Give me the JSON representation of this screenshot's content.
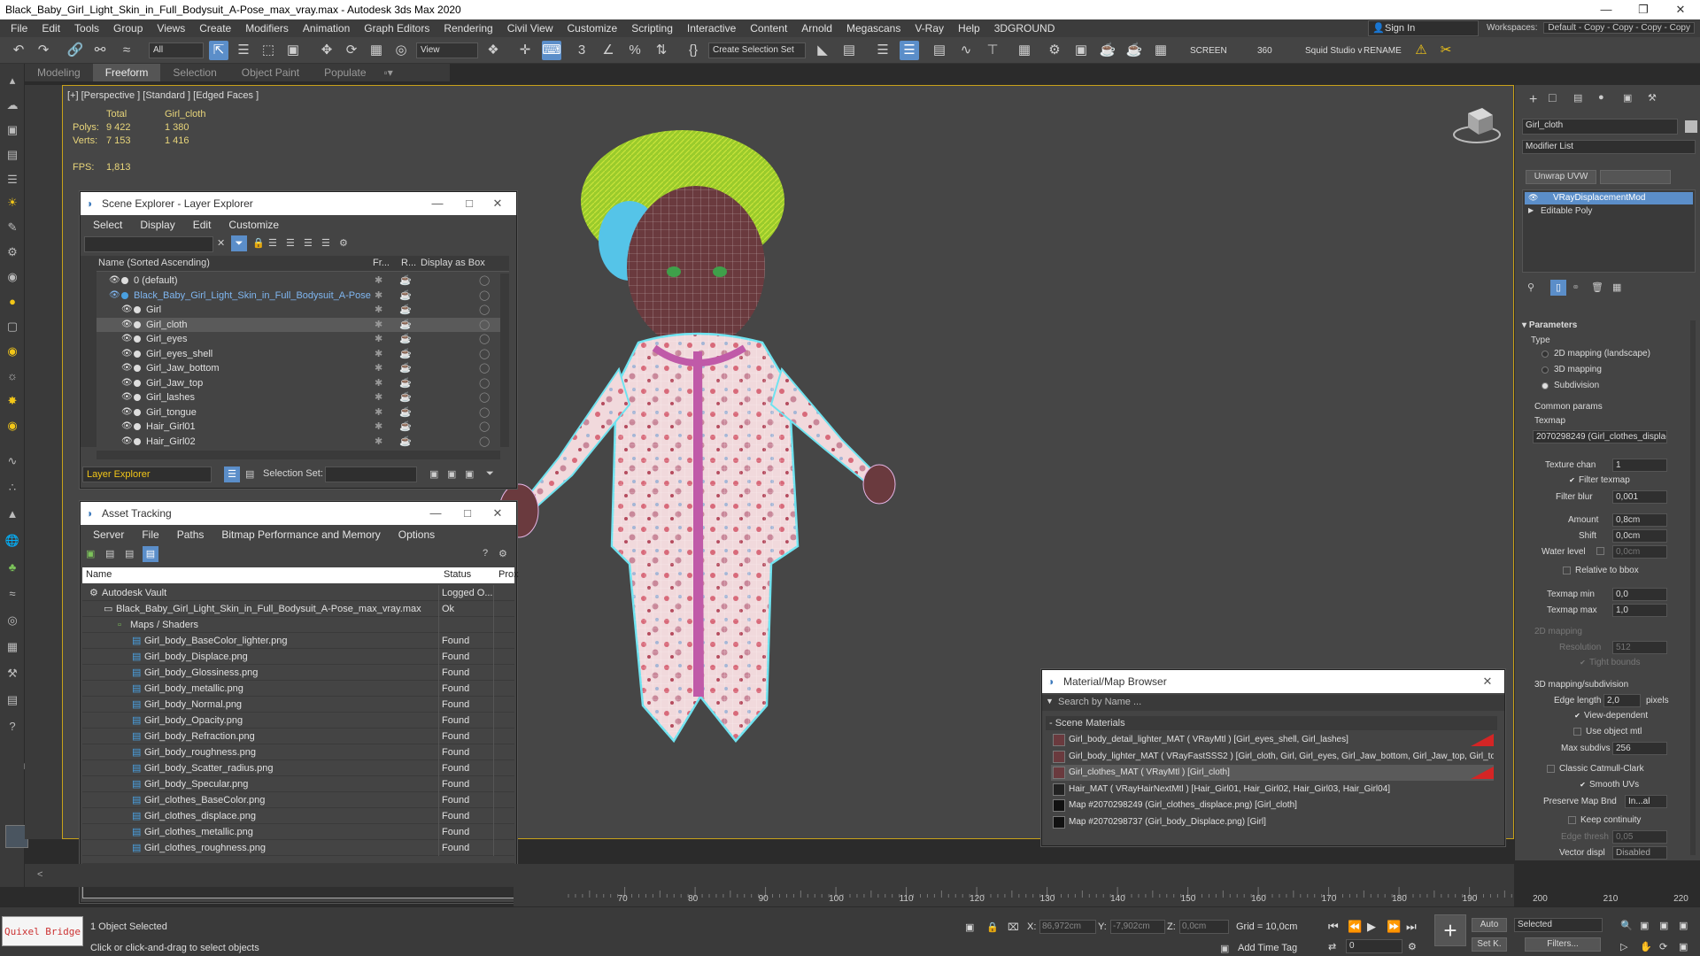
{
  "window": {
    "title": "Black_Baby_Girl_Light_Skin_in_Full_Bodysuit_A-Pose_max_vray.max - Autodesk 3ds Max 2020"
  },
  "menu": [
    "File",
    "Edit",
    "Tools",
    "Group",
    "Views",
    "Create",
    "Modifiers",
    "Animation",
    "Graph Editors",
    "Rendering",
    "Civil View",
    "Customize",
    "Scripting",
    "Interactive",
    "Content",
    "Arnold",
    "Megascans",
    "V-Ray",
    "Help",
    "3DGROUND"
  ],
  "signin": "Sign In",
  "workspace": {
    "label": "Workspaces:",
    "value": "Default - Copy - Copy - Copy - Copy"
  },
  "toolbar": {
    "filter": "All",
    "view": "View",
    "selection_set": "Create Selection Set",
    "screen": "SCREEN",
    "angle": "360",
    "squid": "Squid Studio v",
    "rename": "RENAME"
  },
  "ribbon": [
    "Modeling",
    "Freeform",
    "Selection",
    "Object Paint",
    "Populate"
  ],
  "viewport": {
    "label": "[+] [Perspective ] [Standard ] [Edged Faces ]",
    "stats": {
      "total_label": "Total",
      "object_label": "Girl_cloth",
      "polys_label": "Polys:",
      "polys_total": "9 422",
      "polys_obj": "1 380",
      "verts_label": "Verts:",
      "verts_total": "7 153",
      "verts_obj": "1 416",
      "fps_label": "FPS:",
      "fps": "1,813"
    }
  },
  "scene_explorer": {
    "title": "Scene Explorer - Layer Explorer",
    "menu": [
      "Select",
      "Display",
      "Edit",
      "Customize"
    ],
    "col_name": "Name (Sorted Ascending)",
    "col_fr": "Fr...",
    "col_r": "R...",
    "col_box": "Display as Box",
    "rows": [
      {
        "name": "0 (default)",
        "indent": 1
      },
      {
        "name": "Black_Baby_Girl_Light_Skin_in_Full_Bodysuit_A-Pose",
        "indent": 1
      },
      {
        "name": "Girl",
        "indent": 2
      },
      {
        "name": "Girl_cloth",
        "indent": 2
      },
      {
        "name": "Girl_eyes",
        "indent": 2
      },
      {
        "name": "Girl_eyes_shell",
        "indent": 2
      },
      {
        "name": "Girl_Jaw_bottom",
        "indent": 2
      },
      {
        "name": "Girl_Jaw_top",
        "indent": 2
      },
      {
        "name": "Girl_lashes",
        "indent": 2
      },
      {
        "name": "Girl_tongue",
        "indent": 2
      },
      {
        "name": "Hair_Girl01",
        "indent": 2
      },
      {
        "name": "Hair_Girl02",
        "indent": 2
      }
    ],
    "footer_layer": "Layer Explorer",
    "footer_selset": "Selection Set:"
  },
  "asset_tracking": {
    "title": "Asset Tracking",
    "menu": [
      "Server",
      "File",
      "Paths",
      "Bitmap Performance and Memory",
      "Options"
    ],
    "col_name": "Name",
    "col_status": "Status",
    "col_prox": "Prox",
    "rows": [
      {
        "name": "Autodesk Vault",
        "status": "Logged O...",
        "indent": 0
      },
      {
        "name": "Black_Baby_Girl_Light_Skin_in_Full_Bodysuit_A-Pose_max_vray.max",
        "status": "Ok",
        "indent": 1
      },
      {
        "name": "Maps / Shaders",
        "status": "",
        "indent": 2
      },
      {
        "name": "Girl_body_BaseColor_lighter.png",
        "status": "Found",
        "indent": 3
      },
      {
        "name": "Girl_body_Displace.png",
        "status": "Found",
        "indent": 3
      },
      {
        "name": "Girl_body_Glossiness.png",
        "status": "Found",
        "indent": 3
      },
      {
        "name": "Girl_body_metallic.png",
        "status": "Found",
        "indent": 3
      },
      {
        "name": "Girl_body_Normal.png",
        "status": "Found",
        "indent": 3
      },
      {
        "name": "Girl_body_Opacity.png",
        "status": "Found",
        "indent": 3
      },
      {
        "name": "Girl_body_Refraction.png",
        "status": "Found",
        "indent": 3
      },
      {
        "name": "Girl_body_roughness.png",
        "status": "Found",
        "indent": 3
      },
      {
        "name": "Girl_body_Scatter_radius.png",
        "status": "Found",
        "indent": 3
      },
      {
        "name": "Girl_body_Specular.png",
        "status": "Found",
        "indent": 3
      },
      {
        "name": "Girl_clothes_BaseColor.png",
        "status": "Found",
        "indent": 3
      },
      {
        "name": "Girl_clothes_displace.png",
        "status": "Found",
        "indent": 3
      },
      {
        "name": "Girl_clothes_metallic.png",
        "status": "Found",
        "indent": 3
      },
      {
        "name": "Girl_clothes_roughness.png",
        "status": "Found",
        "indent": 3
      }
    ]
  },
  "material_browser": {
    "title": "Material/Map Browser",
    "search_placeholder": "Search by Name ...",
    "section": "- Scene Materials",
    "rows": [
      {
        "text": "Girl_body_detail_lighter_MAT  ( VRayMtl )  [Girl_eyes_shell, Girl_lashes]",
        "flag": true
      },
      {
        "text": "Girl_body_lighter_MAT  ( VRayFastSSS2 )  [Girl_cloth, Girl, Girl_eyes, Girl_Jaw_bottom, Girl_Jaw_top, Girl_tongue]",
        "flag": false
      },
      {
        "text": "Girl_clothes_MAT  ( VRayMtl )  [Girl_cloth]",
        "flag": true
      },
      {
        "text": "Hair_MAT  ( VRayHairNextMtl )  [Hair_Girl01, Hair_Girl02, Hair_Girl03, Hair_Girl04]",
        "flag": false
      },
      {
        "text": "Map #2070298249 (Girl_clothes_displace.png)  [Girl_cloth]",
        "flag": false
      },
      {
        "text": "Map #2070298737 (Girl_body_Displace.png)  [Girl]",
        "flag": false
      }
    ]
  },
  "command_panel": {
    "object_name": "Girl_cloth",
    "modifier_list": "Modifier List",
    "unwrap": "Unwrap UVW",
    "stack": [
      "VRayDisplacementMod",
      "Editable Poly"
    ],
    "parameters": "Parameters",
    "type_label": "Type",
    "type_options": [
      "2D mapping (landscape)",
      "3D mapping",
      "Subdivision"
    ],
    "common_params": "Common params",
    "texmap_label": "Texmap",
    "texmap_value": "2070298249 (Girl_clothes_displac",
    "texture_chan_label": "Texture chan",
    "texture_chan": "1",
    "filter_texmap": "Filter texmap",
    "filter_blur_label": "Filter blur",
    "filter_blur": "0,001",
    "amount_label": "Amount",
    "amount": "0,8cm",
    "shift_label": "Shift",
    "shift": "0,0cm",
    "water_label": "Water level",
    "water": "0,0cm",
    "relative_bbox": "Relative to bbox",
    "texmap_min_label": "Texmap min",
    "texmap_min": "0,0",
    "texmap_max_label": "Texmap max",
    "texmap_max": "1,0",
    "mapping2d": "2D mapping",
    "resolution_label": "Resolution",
    "resolution": "512",
    "tight_bounds": "Tight bounds",
    "mapping3d": "3D mapping/subdivision",
    "edge_length_label": "Edge length",
    "edge_length": "2,0",
    "pixels": "pixels",
    "view_dependent": "View-dependent",
    "use_object_mtl": "Use object mtl",
    "max_subdivs_label": "Max subdivs",
    "max_subdivs": "256",
    "classic_cc": "Classic Catmull-Clark",
    "smooth_uvs": "Smooth UVs",
    "preserve_map_label": "Preserve Map Bnd",
    "preserve_map": "In...al",
    "keep_continuity": "Keep continuity",
    "edge_thresh_label": "Edge thresh",
    "edge_thresh": "0,05",
    "vector_displ_label": "Vector displ",
    "vector_displ": "Disabled"
  },
  "timeline": {
    "ticks": [
      "70",
      "80",
      "90",
      "100",
      "110",
      "120",
      "130",
      "140",
      "150",
      "160",
      "170",
      "180",
      "190",
      "200",
      "210",
      "220"
    ]
  },
  "status": {
    "quixel": "Quixel Bridge",
    "selected": "1 Object Selected",
    "hint": "Click or click-and-drag to select objects",
    "x_label": "X:",
    "x": "86,972cm",
    "y_label": "Y:",
    "y": "-7,902cm",
    "z_label": "Z:",
    "z": "0,0cm",
    "grid": "Grid = 10,0cm",
    "add_time_tag": "Add Time Tag",
    "auto": "Auto",
    "selected_dd": "Selected",
    "setk": "Set K.",
    "filters": "Filters...",
    "frame": "0"
  }
}
